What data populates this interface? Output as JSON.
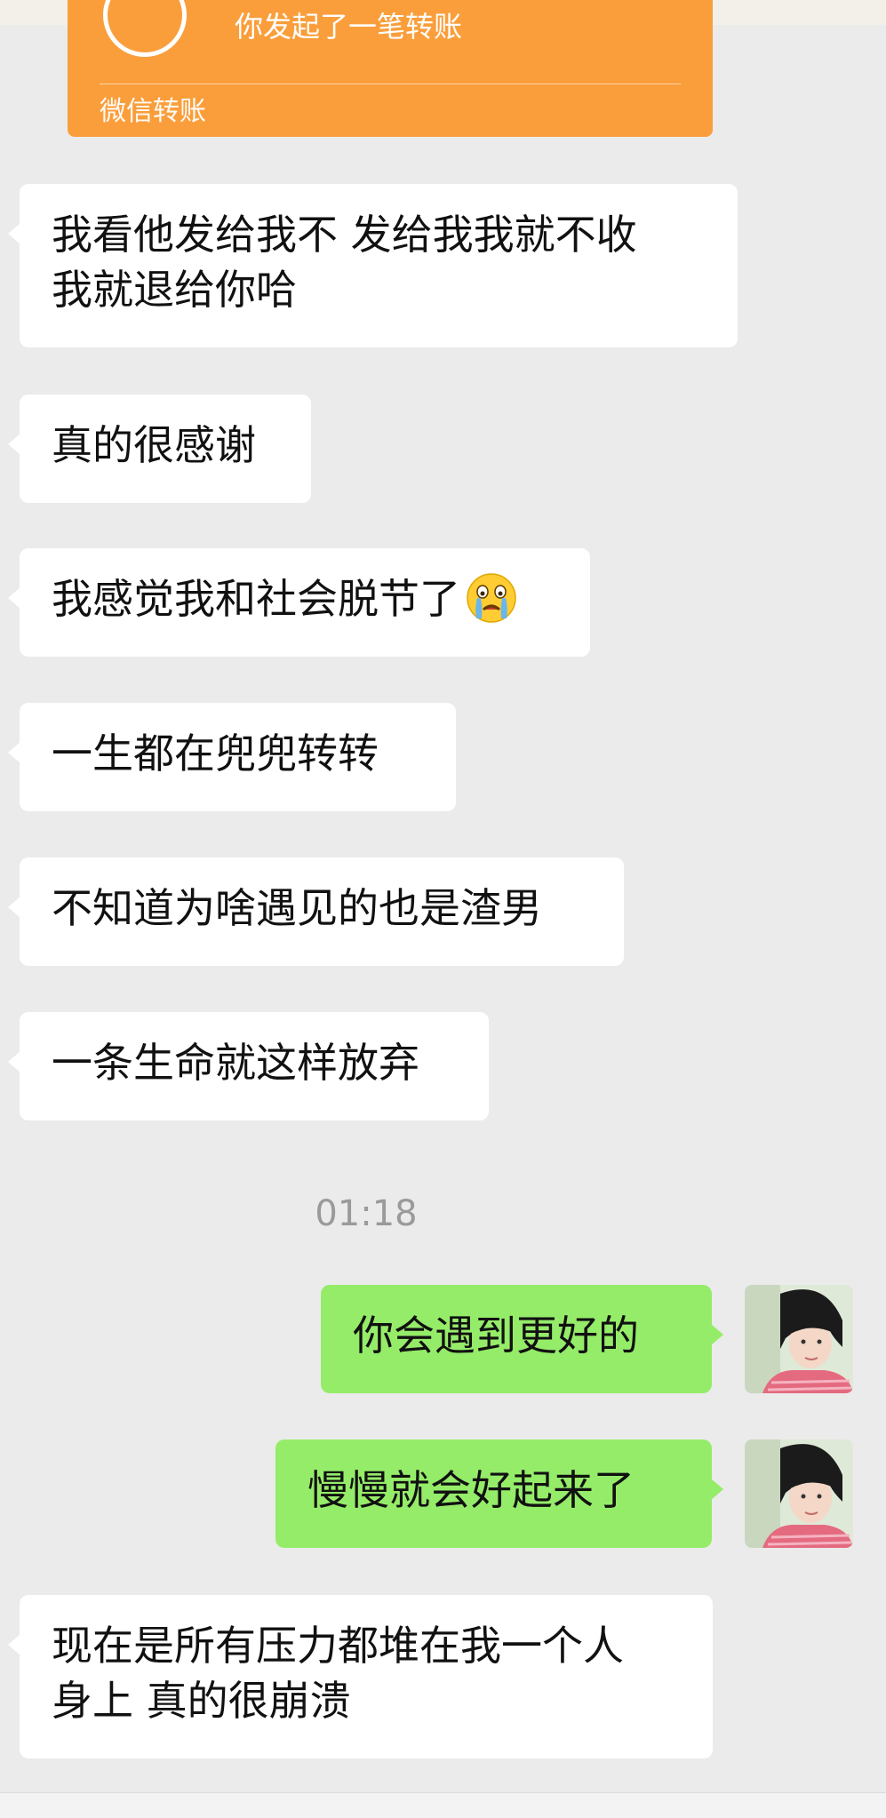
{
  "transfer": {
    "title": "你发起了一笔转账",
    "footer": "微信转账"
  },
  "messages": [
    {
      "text": "我看他发给我不 发给我我就不收\n我就退给你哈"
    },
    {
      "text": "真的很感谢"
    },
    {
      "text": "我感觉我和社会脱节了"
    },
    {
      "text": "一生都在兜兜转转"
    },
    {
      "text": "不知道为啥遇见的也是渣男"
    },
    {
      "text": "一条生命就这样放弃"
    },
    {
      "text": "你会遇到更好的"
    },
    {
      "text": "慢慢就会好起来了"
    },
    {
      "text": "现在是所有压力都堆在我一个人\n身上 真的很崩溃"
    }
  ],
  "emoji": {
    "name": "crying-face-icon"
  },
  "timestamp": "01:18",
  "colors": {
    "background": "#ebebeb",
    "incoming_bubble": "#ffffff",
    "outgoing_bubble": "#95ec69",
    "transfer_card": "#fa9e3b",
    "timestamp_text": "#9a9a9a"
  }
}
